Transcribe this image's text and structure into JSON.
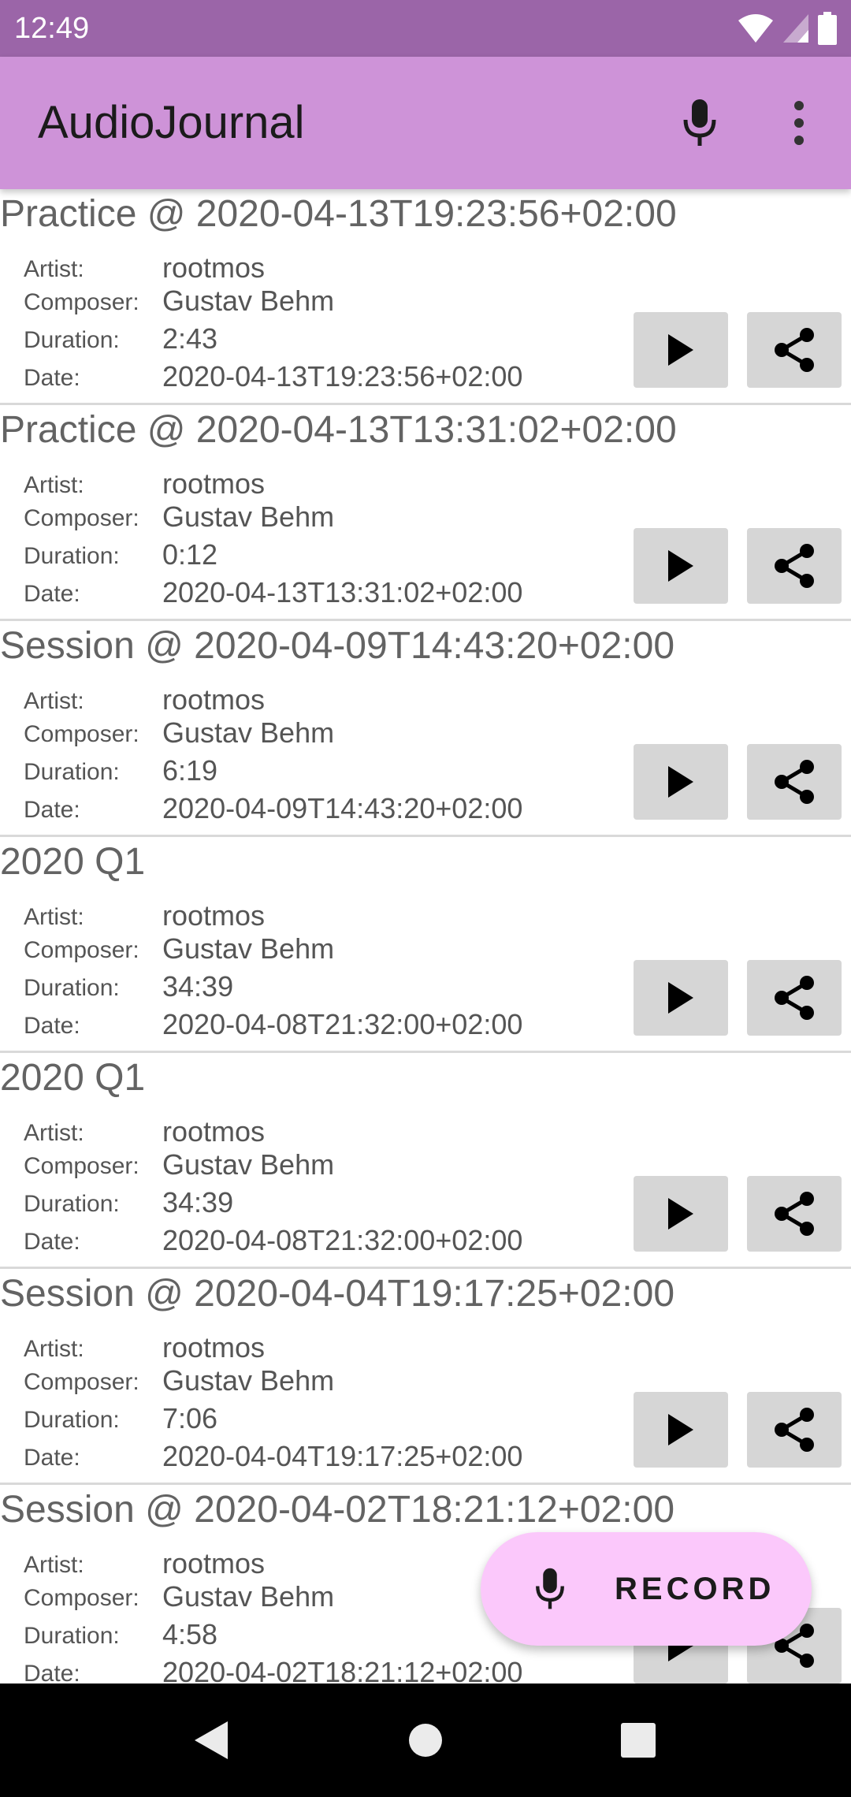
{
  "status_bar": {
    "time": "12:49",
    "icons": [
      "wifi-icon",
      "signal-icon",
      "battery-icon"
    ]
  },
  "app_bar": {
    "title": "AudioJournal",
    "actions": [
      "mic-icon",
      "more-vert-icon"
    ]
  },
  "labels": {
    "artist": "Artist:",
    "composer": "Composer:",
    "duration": "Duration:",
    "date": "Date:"
  },
  "recordings": [
    {
      "title": "Practice @ 2020-04-13T19:23:56+02:00",
      "artist": "rootmos",
      "composer": "Gustav Behm",
      "duration": "2:43",
      "date": "2020-04-13T19:23:56+02:00"
    },
    {
      "title": "Practice @ 2020-04-13T13:31:02+02:00",
      "artist": "rootmos",
      "composer": "Gustav Behm",
      "duration": "0:12",
      "date": "2020-04-13T13:31:02+02:00"
    },
    {
      "title": "Session @ 2020-04-09T14:43:20+02:00",
      "artist": "rootmos",
      "composer": "Gustav Behm",
      "duration": "6:19",
      "date": "2020-04-09T14:43:20+02:00"
    },
    {
      "title": "2020 Q1",
      "artist": "rootmos",
      "composer": "Gustav Behm",
      "duration": "34:39",
      "date": "2020-04-08T21:32:00+02:00"
    },
    {
      "title": "2020 Q1",
      "artist": "rootmos",
      "composer": "Gustav Behm",
      "duration": "34:39",
      "date": "2020-04-08T21:32:00+02:00"
    },
    {
      "title": "Session @ 2020-04-04T19:17:25+02:00",
      "artist": "rootmos",
      "composer": "Gustav Behm",
      "duration": "7:06",
      "date": "2020-04-04T19:17:25+02:00"
    },
    {
      "title": "Session @ 2020-04-02T18:21:12+02:00",
      "artist": "rootmos",
      "composer": "Gustav Behm",
      "duration": "4:58",
      "date": "2020-04-02T18:21:12+02:00"
    }
  ],
  "fab": {
    "label": "RECORD",
    "icon": "mic-icon"
  },
  "nav_bar": {
    "buttons": [
      "back-icon",
      "home-icon",
      "recents-icon"
    ]
  },
  "colors": {
    "status_bar": "#9b65a8",
    "app_bar": "#ce93d8",
    "fab": "#fbc8fb",
    "button_bg": "#d6d6d6"
  }
}
